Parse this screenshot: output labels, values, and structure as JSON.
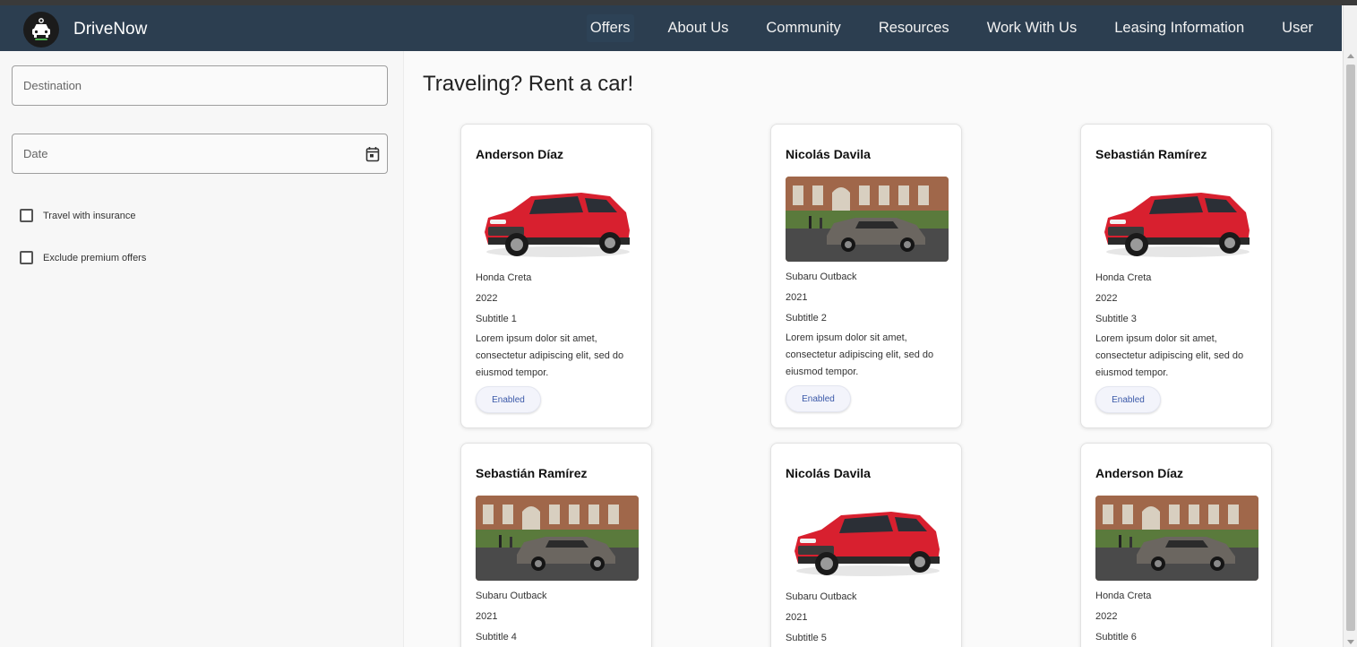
{
  "navbar": {
    "brand": "DriveNow",
    "links": [
      "Offers",
      "About Us",
      "Community",
      "Resources",
      "Work With Us",
      "Leasing Information",
      "User"
    ],
    "active": "Offers"
  },
  "filters": {
    "destination_placeholder": "Destination",
    "date_placeholder": "Date",
    "checkboxes": [
      {
        "label": "Travel with insurance",
        "checked": false
      },
      {
        "label": "Exclude premium offers",
        "checked": false
      }
    ]
  },
  "main": {
    "title": "Traveling? Rent a car!"
  },
  "cards": [
    {
      "owner": "Anderson Díaz",
      "model": "Honda Creta",
      "year": "2022",
      "subtitle": "Subtitle 1",
      "description": "Lorem ipsum dolor sit amet, consectetur adipiscing elit, sed do eiusmod tempor.",
      "status": "Enabled",
      "image": "red-suv"
    },
    {
      "owner": "Nicolás Davila",
      "model": "Subaru Outback",
      "year": "2021",
      "subtitle": "Subtitle 2",
      "description": "Lorem ipsum dolor sit amet, consectetur adipiscing elit, sed do eiusmod tempor.",
      "status": "Enabled",
      "image": "gray-suv-campus"
    },
    {
      "owner": "Sebastián Ramírez",
      "model": "Honda Creta",
      "year": "2022",
      "subtitle": "Subtitle 3",
      "description": "Lorem ipsum dolor sit amet, consectetur adipiscing elit, sed do eiusmod tempor.",
      "status": "Enabled",
      "image": "red-suv"
    },
    {
      "owner": "Sebastián Ramírez",
      "model": "Subaru Outback",
      "year": "2021",
      "subtitle": "Subtitle 4",
      "image": "gray-suv-campus"
    },
    {
      "owner": "Nicolás Davila",
      "model": "Subaru Outback",
      "year": "2021",
      "subtitle": "Subtitle 5",
      "image": "red-suv"
    },
    {
      "owner": "Anderson Díaz",
      "model": "Honda Creta",
      "year": "2022",
      "subtitle": "Subtitle 6",
      "image": "gray-suv-campus"
    }
  ],
  "colors": {
    "navbar": "#2c3e50",
    "chip_text": "#3a58a8",
    "car_red": "#d8202f",
    "car_gray": "#6b6660"
  }
}
